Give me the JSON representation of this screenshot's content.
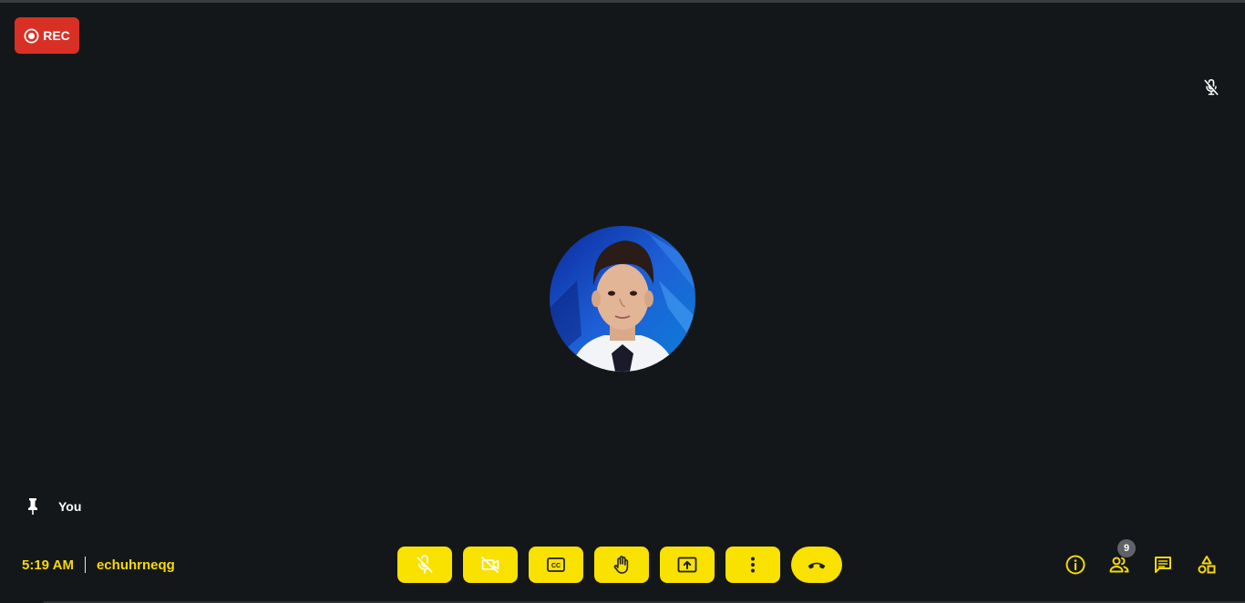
{
  "recording": {
    "label": "REC",
    "icon": "record-icon",
    "color": "#d93025"
  },
  "remote_status": {
    "icon": "mic-off-icon"
  },
  "participant": {
    "avatar": "participant-photo"
  },
  "self_tile": {
    "icon": "pin-icon",
    "name": "You"
  },
  "meeting": {
    "time": "5:19 AM",
    "code": "echuhrneqg",
    "accent": "#f5d90a"
  },
  "controls": [
    {
      "name": "microphone-toggle",
      "icon": "mic-off-icon"
    },
    {
      "name": "camera-toggle",
      "icon": "video-off-icon"
    },
    {
      "name": "captions-toggle",
      "icon": "closed-captions-icon"
    },
    {
      "name": "raise-hand",
      "icon": "hand-icon"
    },
    {
      "name": "present-screen",
      "icon": "present-to-all-icon"
    },
    {
      "name": "more-options",
      "icon": "more-vert-icon"
    },
    {
      "name": "leave-call",
      "icon": "call-end-icon"
    }
  ],
  "control_color": "#f9e100",
  "side_controls": {
    "info": {
      "icon": "info-icon"
    },
    "people": {
      "icon": "people-icon",
      "count": "9"
    },
    "chat": {
      "icon": "chat-icon"
    },
    "activities": {
      "icon": "activities-icon"
    }
  },
  "background": "#141719"
}
